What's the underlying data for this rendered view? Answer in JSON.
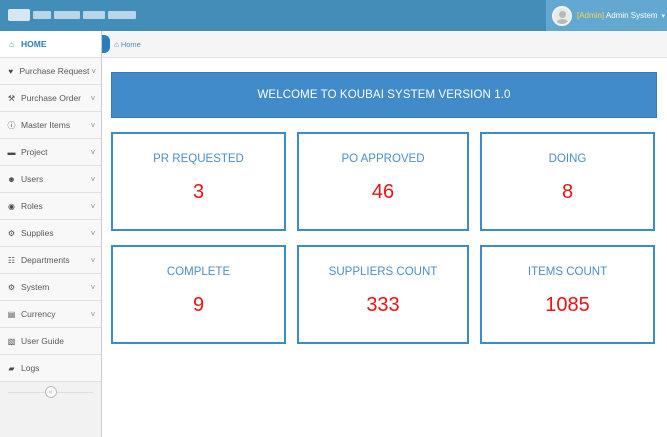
{
  "header": {
    "user_role": "[Admin]",
    "user_name": "Admin System"
  },
  "breadcrumb": {
    "home": "Home"
  },
  "sidebar": {
    "items": [
      {
        "label": "HOME",
        "icon": "home-icon",
        "glyph": "⌂",
        "chevron": false,
        "active": true
      },
      {
        "label": "Purchase Request",
        "icon": "heart-icon",
        "glyph": "♥",
        "chevron": true
      },
      {
        "label": "Purchase Order",
        "icon": "gavel-icon",
        "glyph": "⚒",
        "chevron": true
      },
      {
        "label": "Master Items",
        "icon": "info-icon",
        "glyph": "ⓘ",
        "chevron": true
      },
      {
        "label": "Project",
        "icon": "folder-icon",
        "glyph": "▬",
        "chevron": true
      },
      {
        "label": "Users",
        "icon": "users-icon",
        "glyph": "☻",
        "chevron": true
      },
      {
        "label": "Roles",
        "icon": "roles-icon",
        "glyph": "◉",
        "chevron": true
      },
      {
        "label": "Supplies",
        "icon": "supplies-icon",
        "glyph": "⚙",
        "chevron": true
      },
      {
        "label": "Departments",
        "icon": "grid-icon",
        "glyph": "☷",
        "chevron": true
      },
      {
        "label": "System",
        "icon": "gear-icon",
        "glyph": "⚙",
        "chevron": true
      },
      {
        "label": "Currency",
        "icon": "currency-icon",
        "glyph": "▤",
        "chevron": true
      },
      {
        "label": "User Guide",
        "icon": "book-icon",
        "glyph": "▧",
        "chevron": false
      },
      {
        "label": "Logs",
        "icon": "logs-icon",
        "glyph": "▰",
        "chevron": false
      }
    ]
  },
  "main": {
    "welcome": "WELCOME TO KOUBAI SYSTEM VERSION 1.0",
    "cards": [
      {
        "title": "PR REQUESTED",
        "value": "3"
      },
      {
        "title": "PO APPROVED",
        "value": "46"
      },
      {
        "title": "DOING",
        "value": "8"
      },
      {
        "title": "COMPLETE",
        "value": "9"
      },
      {
        "title": "SUPPLIERS COUNT",
        "value": "333"
      },
      {
        "title": "ITEMS COUNT",
        "value": "1085"
      }
    ]
  },
  "colors": {
    "topbar": "#438eb9",
    "accent": "#428bca",
    "value": "#ee1111"
  }
}
